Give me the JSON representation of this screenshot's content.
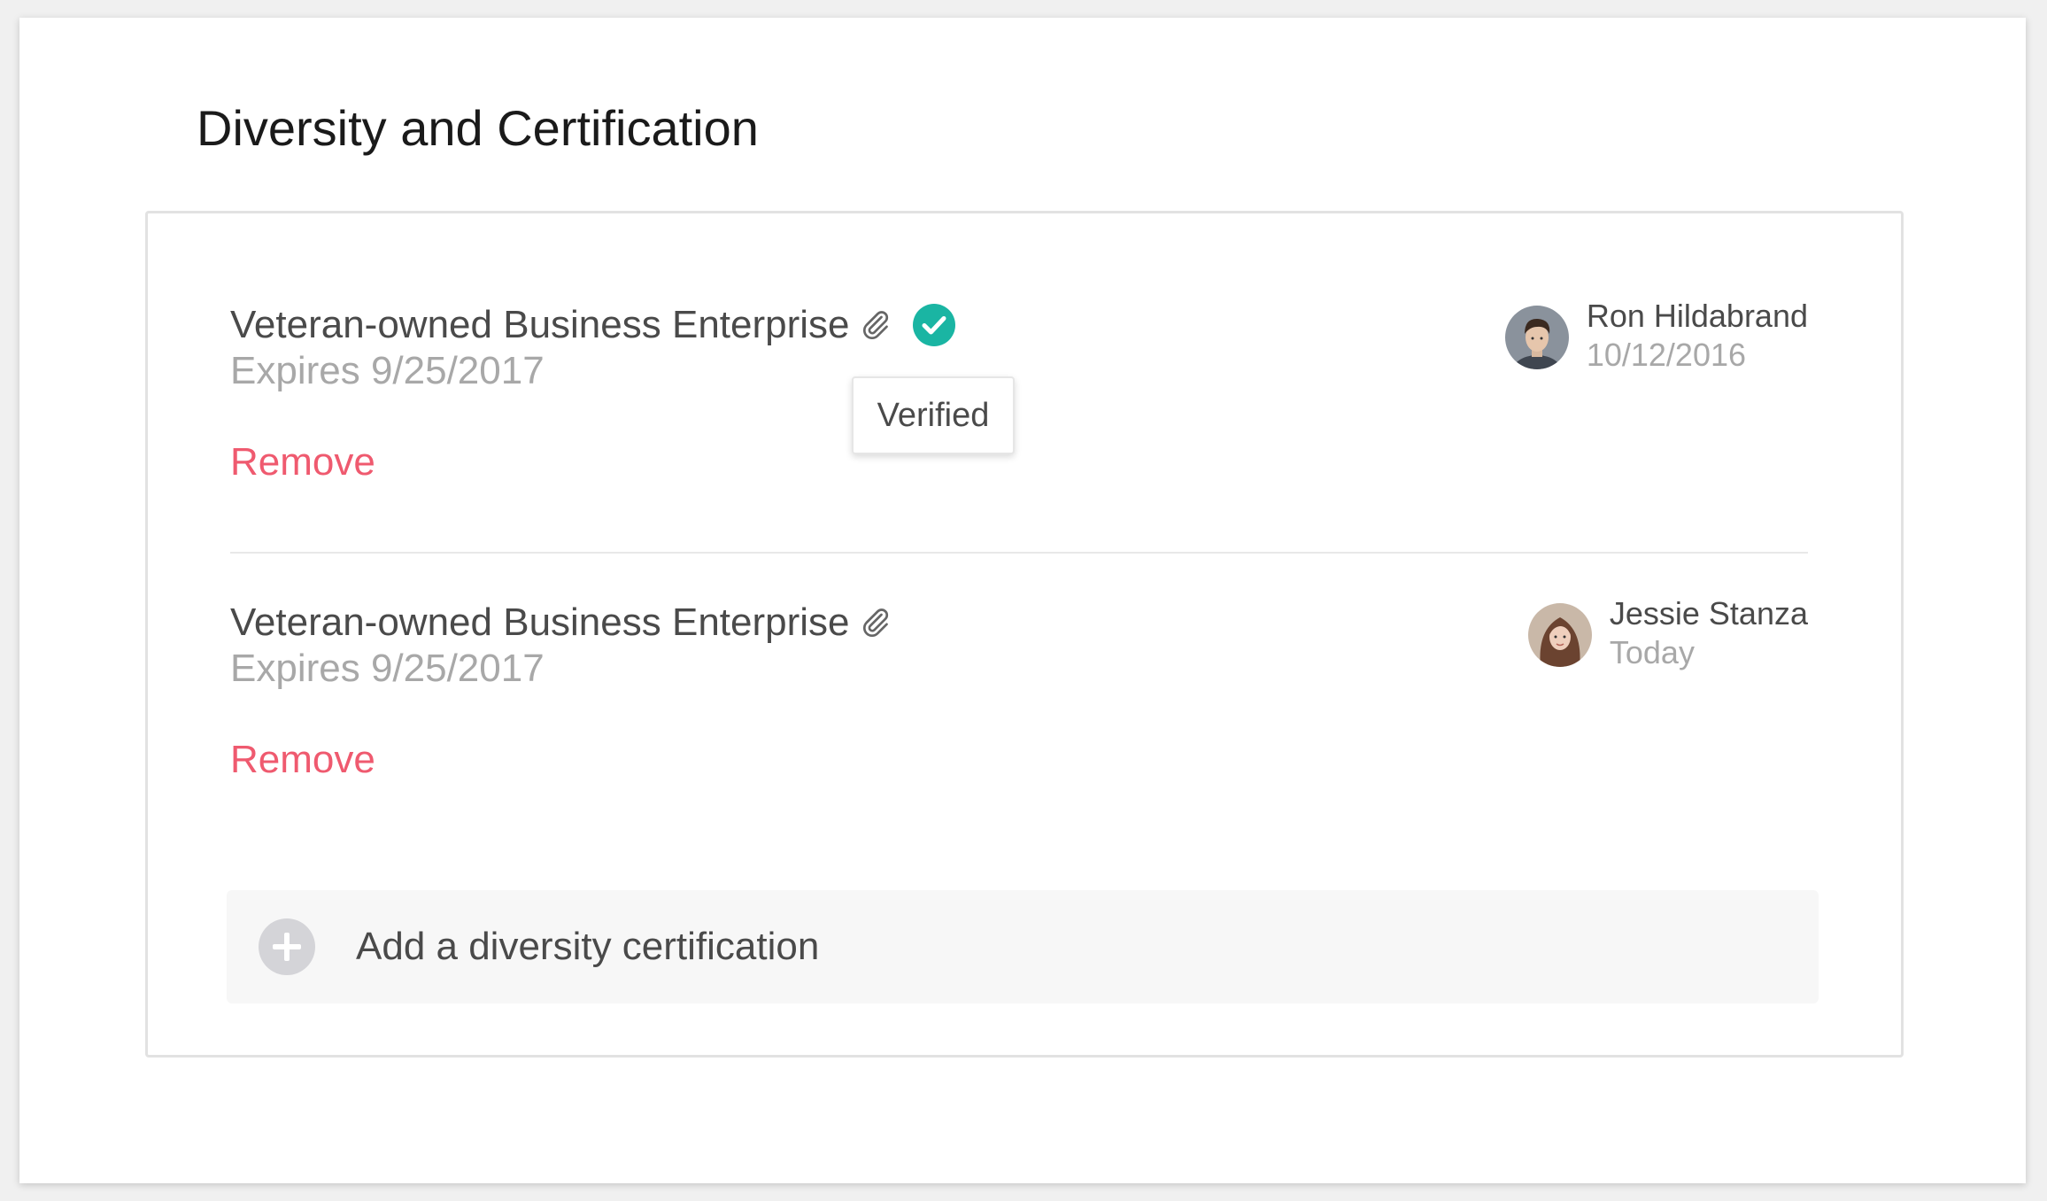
{
  "page": {
    "title": "Diversity and Certification"
  },
  "certifications": [
    {
      "name": "Veteran-owned Business Enterprise",
      "expires": "Expires 9/25/2017",
      "verified": true,
      "attachment_icon": "paperclip-icon",
      "remove_label": "Remove",
      "user_name": "Ron Hildabrand",
      "user_date": "10/12/2016"
    },
    {
      "name": "Veteran-owned Business Enterprise",
      "expires": "Expires 9/25/2017",
      "verified": false,
      "attachment_icon": "paperclip-icon",
      "remove_label": "Remove",
      "user_name": "Jessie Stanza",
      "user_date": "Today"
    }
  ],
  "tooltip": {
    "text": "Verified"
  },
  "add": {
    "label": "Add a diversity certification",
    "icon": "plus-circle-icon"
  },
  "colors": {
    "remove": "#ef5a6f",
    "verified": "#1ab5a3",
    "muted": "#a8a8a8",
    "text": "#4a4a4a"
  }
}
